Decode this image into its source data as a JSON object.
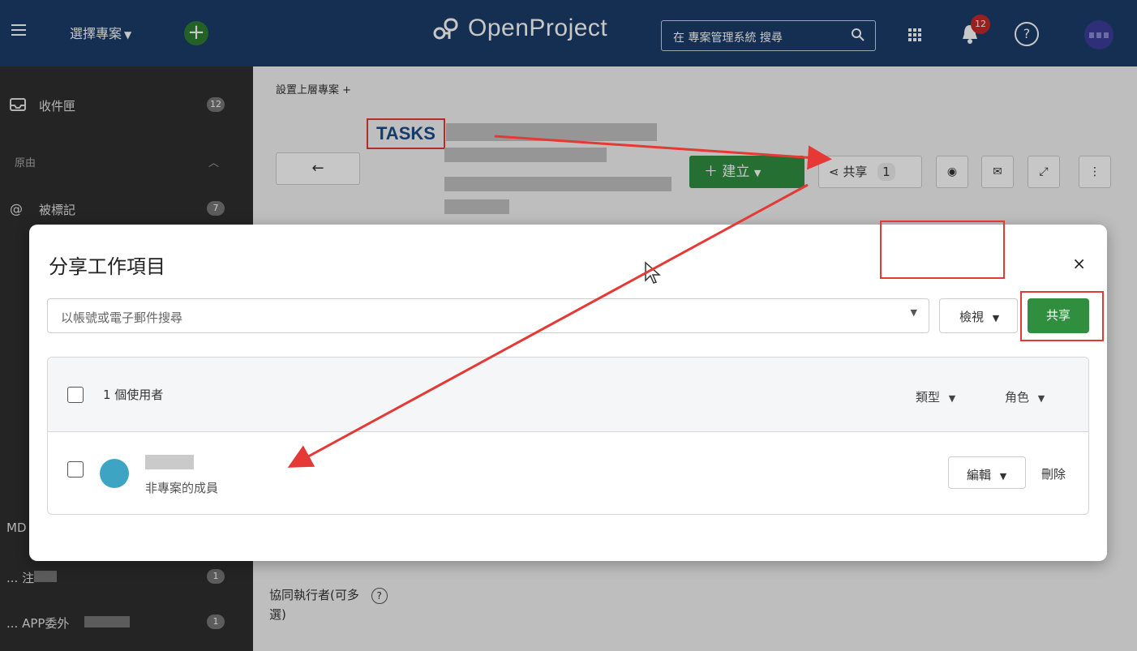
{
  "header": {
    "project_selector": "選擇專案",
    "logo": "OpenProject",
    "search_placeholder": "在 專案管理系統 搜尋",
    "notification_count": "12",
    "help": "?"
  },
  "sidebar": {
    "inbox_label": "收件匣",
    "inbox_count": "12",
    "reason_label": "原由",
    "mentioned_label": "被標記",
    "mentioned_count": "7",
    "md_label": "MD",
    "row_dots_label": "... 注",
    "row_dots_count": "1",
    "app_label": "... APP委外",
    "app_count": "1"
  },
  "main": {
    "breadcrumb": "設置上層專案 +",
    "tasks_type": "TASKS",
    "create_button": "建立",
    "share_button": "共享",
    "share_count": "1",
    "coexec_label": "協同執行者(可多",
    "coexec_label_2": "選)",
    "coexec_help": "?"
  },
  "modal": {
    "title": "分享工作項目",
    "close": "×",
    "search_placeholder": "以帳號或電子郵件搜尋",
    "view_button": "檢視",
    "share_button": "共享",
    "user_count_text": "1 個使用者",
    "type_filter": "類型",
    "role_filter": "角色",
    "user_note": "非專案的成員",
    "edit_button": "編輯",
    "remove_link": "刪除"
  },
  "colors": {
    "header_bg": "#1a3d6a",
    "sidebar_bg": "#2f2f2f",
    "primary_green": "#2f8f3f",
    "annotation_red": "#e53935"
  }
}
